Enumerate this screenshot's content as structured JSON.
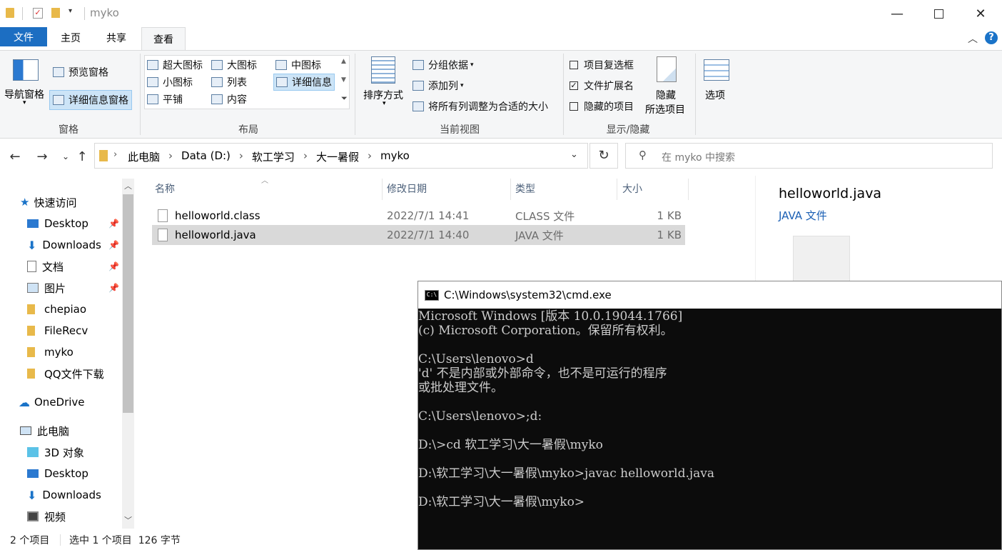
{
  "window": {
    "title": "myko"
  },
  "ribbon_tabs": [
    {
      "label": "文件"
    },
    {
      "label": "主页"
    },
    {
      "label": "共享"
    },
    {
      "label": "查看"
    }
  ],
  "ribbon": {
    "panes": {
      "nav_pane": "导航窗格",
      "preview_pane": "预览窗格",
      "details_pane": "详细信息窗格",
      "group_label": "窗格"
    },
    "layout": {
      "items": [
        "超大图标",
        "大图标",
        "中图标",
        "小图标",
        "列表",
        "详细信息",
        "平铺",
        "内容"
      ],
      "group_label": "布局"
    },
    "current_view": {
      "sort_by": "排序方式",
      "group_by": "分组依据",
      "add_column": "添加列",
      "fit_columns": "将所有列调整为合适的大小",
      "group_label": "当前视图"
    },
    "show_hide": {
      "item_checkboxes": "项目复选框",
      "file_extensions": "文件扩展名",
      "hidden_items": "隐藏的项目",
      "hide_selected_line1": "隐藏",
      "hide_selected_line2": "所选项目",
      "group_label": "显示/隐藏",
      "checkmark": "✓"
    },
    "options": "选项"
  },
  "address": {
    "crumbs": [
      "此电脑",
      "Data (D:)",
      "软工学习",
      "大一暑假",
      "myko"
    ],
    "search_placeholder": "在 myko 中搜索"
  },
  "sidebar": {
    "items": [
      {
        "label": "快速访问",
        "icon": "star-icon"
      },
      {
        "label": "Desktop",
        "icon": "desktop-icon",
        "pinned": true
      },
      {
        "label": "Downloads",
        "icon": "download-icon",
        "pinned": true
      },
      {
        "label": "文档",
        "icon": "document-icon",
        "pinned": true
      },
      {
        "label": "图片",
        "icon": "picture-icon",
        "pinned": true
      },
      {
        "label": "chepiao",
        "icon": "folder-icon"
      },
      {
        "label": "FileRecv",
        "icon": "folder-icon"
      },
      {
        "label": "myko",
        "icon": "folder-icon"
      },
      {
        "label": "QQ文件下载",
        "icon": "folder-icon"
      },
      {
        "label": "OneDrive",
        "icon": "cloud-icon"
      },
      {
        "label": "此电脑",
        "icon": "computer-icon"
      },
      {
        "label": "3D 对象",
        "icon": "cube-icon"
      },
      {
        "label": "Desktop",
        "icon": "desktop-icon"
      },
      {
        "label": "Downloads",
        "icon": "download-icon"
      },
      {
        "label": "视频",
        "icon": "video-icon"
      }
    ]
  },
  "files": {
    "columns": {
      "name": "名称",
      "modified": "修改日期",
      "type": "类型",
      "size": "大小"
    },
    "rows": [
      {
        "name": "helloworld.class",
        "modified": "2022/7/1 14:41",
        "type": "CLASS 文件",
        "size": "1 KB",
        "selected": false
      },
      {
        "name": "helloworld.java",
        "modified": "2022/7/1 14:40",
        "type": "JAVA 文件",
        "size": "1 KB",
        "selected": true
      }
    ]
  },
  "preview": {
    "filename": "helloworld.java",
    "filetype": "JAVA 文件"
  },
  "status": {
    "count": "2 个项目",
    "selection": "选中 1 个项目  126 字节"
  },
  "cmd": {
    "title": "C:\\Windows\\system32\\cmd.exe",
    "icon_label": "C:\\",
    "lines": [
      "Microsoft Windows [版本 10.0.19044.1766]",
      "(c) Microsoft Corporation。保留所有权利。",
      "",
      "C:\\Users\\lenovo>d",
      "'d' 不是内部或外部命令，也不是可运行的程序",
      "或批处理文件。",
      "",
      "C:\\Users\\lenovo>;d:",
      "",
      "D:\\>cd 软工学习\\大一暑假\\myko",
      "",
      "D:\\软工学习\\大一暑假\\myko>javac helloworld.java",
      "",
      "D:\\软工学习\\大一暑假\\myko>"
    ]
  },
  "colors": {
    "accent": "#1a73c8",
    "file_tab": "#1c6ec2",
    "selected_row": "#d9d9d9",
    "cmd_bg": "#0c0c0c",
    "cmd_fg": "#cccccc"
  }
}
